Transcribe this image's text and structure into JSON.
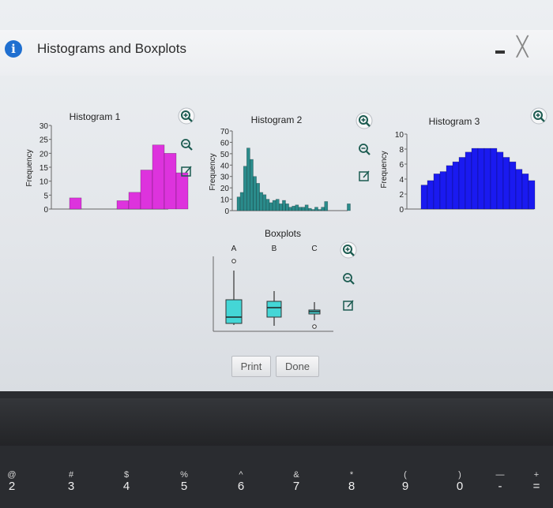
{
  "window": {
    "title": "Histograms and Boxplots"
  },
  "buttons": {
    "print": "Print",
    "done": "Done"
  },
  "icons": {
    "zoom_in": "zoom-in-icon",
    "zoom_out": "zoom-out-icon",
    "popout": "popout-icon",
    "info": "info-icon"
  },
  "colors": {
    "hist1": "#dd33dd",
    "hist2": "#2a8b8b",
    "hist3": "#1a1af0",
    "box": "#44d6d6"
  },
  "chart_data": [
    {
      "type": "bar",
      "title": "Histogram 1",
      "ylabel": "Frequency",
      "ylim": [
        0,
        30
      ],
      "yticks": [
        0,
        5,
        10,
        15,
        20,
        25,
        30
      ],
      "values": [
        4,
        0,
        0,
        0,
        3,
        6,
        14,
        23,
        20,
        13
      ]
    },
    {
      "type": "bar",
      "title": "Histogram 2",
      "ylabel": "Frequency",
      "ylim": [
        0,
        70
      ],
      "yticks": [
        0,
        10,
        20,
        30,
        40,
        50,
        60,
        70
      ],
      "values": [
        12,
        16,
        39,
        55,
        45,
        30,
        24,
        16,
        14,
        10,
        7,
        9,
        10,
        6,
        9,
        6,
        3,
        4,
        5,
        3,
        3,
        5,
        2,
        1,
        3,
        1,
        3,
        8,
        0,
        0,
        0,
        0,
        0,
        0,
        6
      ]
    },
    {
      "type": "bar",
      "title": "Histogram 3",
      "ylabel": "Frequency",
      "ylim": [
        0,
        10
      ],
      "yticks": [
        0,
        2,
        4,
        6,
        8,
        10
      ],
      "values": [
        3.2,
        3.8,
        4.7,
        5.0,
        5.8,
        6.3,
        6.9,
        7.6,
        8.1,
        8.1,
        8.1,
        8.1,
        7.6,
        6.9,
        6.3,
        5.3,
        4.7,
        3.8
      ]
    },
    {
      "type": "boxplot",
      "title": "Boxplots",
      "categories": [
        "A",
        "B",
        "C"
      ]
    }
  ]
}
